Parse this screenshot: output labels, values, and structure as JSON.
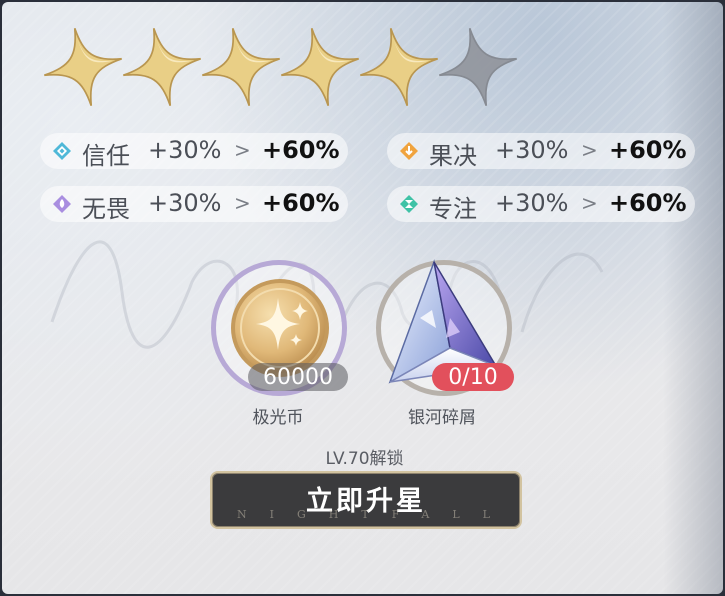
{
  "stars": {
    "total": 6,
    "filled": 5,
    "filled_color": "#e9cf86",
    "empty_color": "#8e9198"
  },
  "stats": [
    {
      "name": "信任",
      "old": "+30%",
      "arrow": ">",
      "new": "+60%",
      "icon": "trust-diamond-icon",
      "icon_color": "#4fb8d8"
    },
    {
      "name": "果决",
      "old": "+30%",
      "arrow": ">",
      "new": "+60%",
      "icon": "decisive-diamond-icon",
      "icon_color": "#f0a33e"
    },
    {
      "name": "无畏",
      "old": "+30%",
      "arrow": ">",
      "new": "+60%",
      "icon": "fearless-diamond-icon",
      "icon_color": "#a98ee0"
    },
    {
      "name": "专注",
      "old": "+30%",
      "arrow": ">",
      "new": "+60%",
      "icon": "focus-diamond-icon",
      "icon_color": "#3fc2a6"
    }
  ],
  "materials": [
    {
      "name": "极光币",
      "count": "60000",
      "icon": "aurora-coin-icon"
    },
    {
      "name": "银河碎屑",
      "count": "0/10",
      "icon": "galaxy-shard-icon",
      "count_color": "#e2505c"
    }
  ],
  "unlock_text": "LV.70解锁",
  "button": {
    "label": "立即升星",
    "decoration": "NIGHTFALL"
  }
}
